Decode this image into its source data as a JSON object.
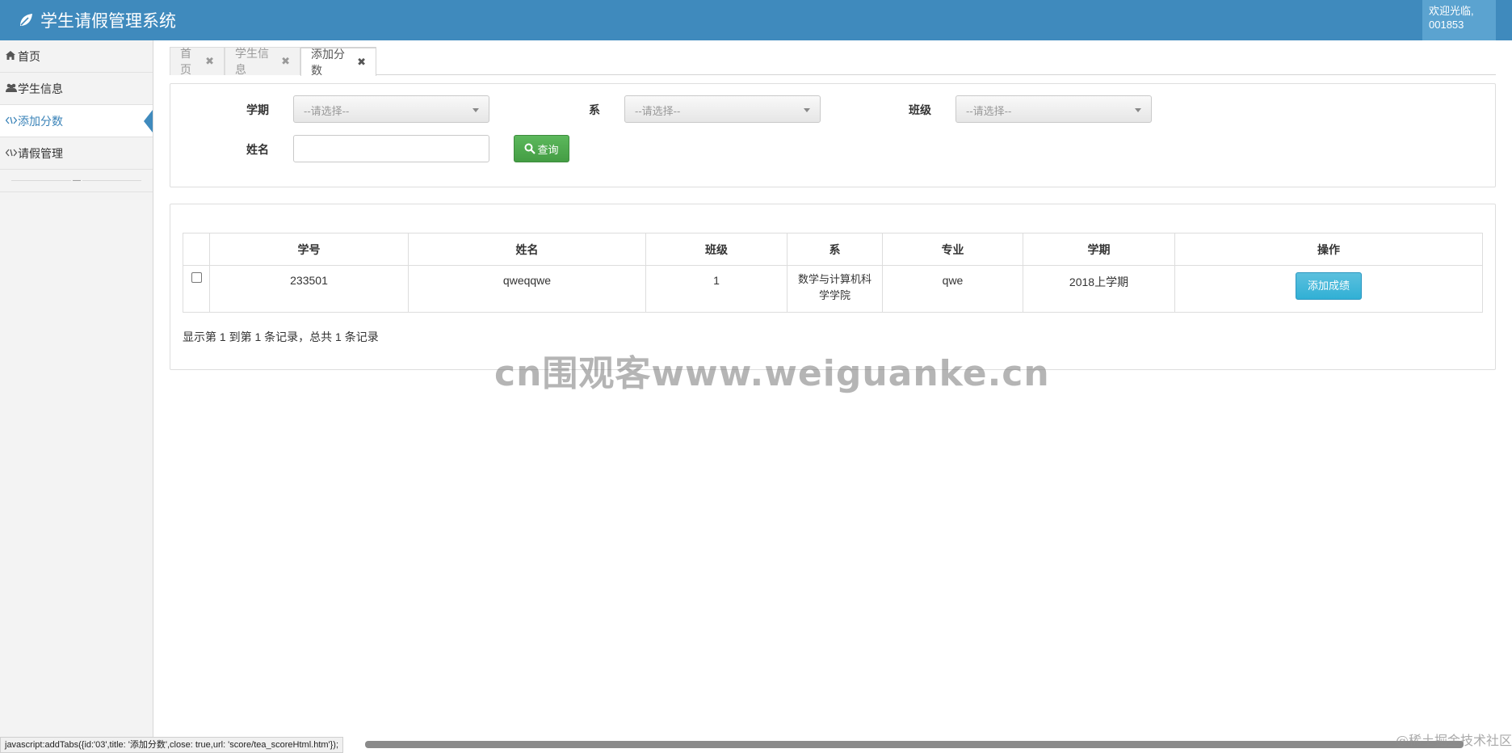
{
  "header": {
    "title": "学生请假管理系统",
    "welcome": "欢迎光临,",
    "user_id": "001853"
  },
  "sidebar": {
    "items": [
      {
        "label": "首页",
        "icon": "home-icon"
      },
      {
        "label": "学生信息",
        "icon": "users-icon"
      },
      {
        "label": "添加分数",
        "icon": "code-icon",
        "active": true
      },
      {
        "label": "请假管理",
        "icon": "code-icon"
      }
    ],
    "collapse_glyph": "—"
  },
  "tabs": [
    {
      "label": "首页",
      "close": "✖"
    },
    {
      "label": "学生信息",
      "close": "✖"
    },
    {
      "label": "添加分数",
      "close": "✖",
      "active": true
    }
  ],
  "search": {
    "term_label": "学期",
    "term_value": "--请选择--",
    "dept_label": "系",
    "dept_value": "--请选择--",
    "class_label": "班级",
    "class_value": "--请选择--",
    "name_label": "姓名",
    "name_value": "",
    "query_button": "查询"
  },
  "table": {
    "headers": [
      "学号",
      "姓名",
      "班级",
      "系",
      "专业",
      "学期",
      "操作"
    ],
    "rows": [
      {
        "id": "233501",
        "name": "qweqqwe",
        "class": "1",
        "dept_line1": "数学与计算机科",
        "dept_line2": "学学院",
        "major": "qwe",
        "term": "2018上学期",
        "action": "添加成绩"
      }
    ]
  },
  "pagination": {
    "info": "显示第 1 到第 1 条记录，总共 1 条记录"
  },
  "watermark": "cn围观客www.weiguanke.cn",
  "status_bar": {
    "text": "javascript:addTabs({id:'03',title: '添加分数',close: true,url: 'score/tea_scoreHtml.htm'});"
  },
  "corner_watermark": "@稀土掘金技术社区",
  "colors": {
    "primary": "#3f8abd",
    "success": "#5cb85c",
    "info": "#5bc0de"
  }
}
